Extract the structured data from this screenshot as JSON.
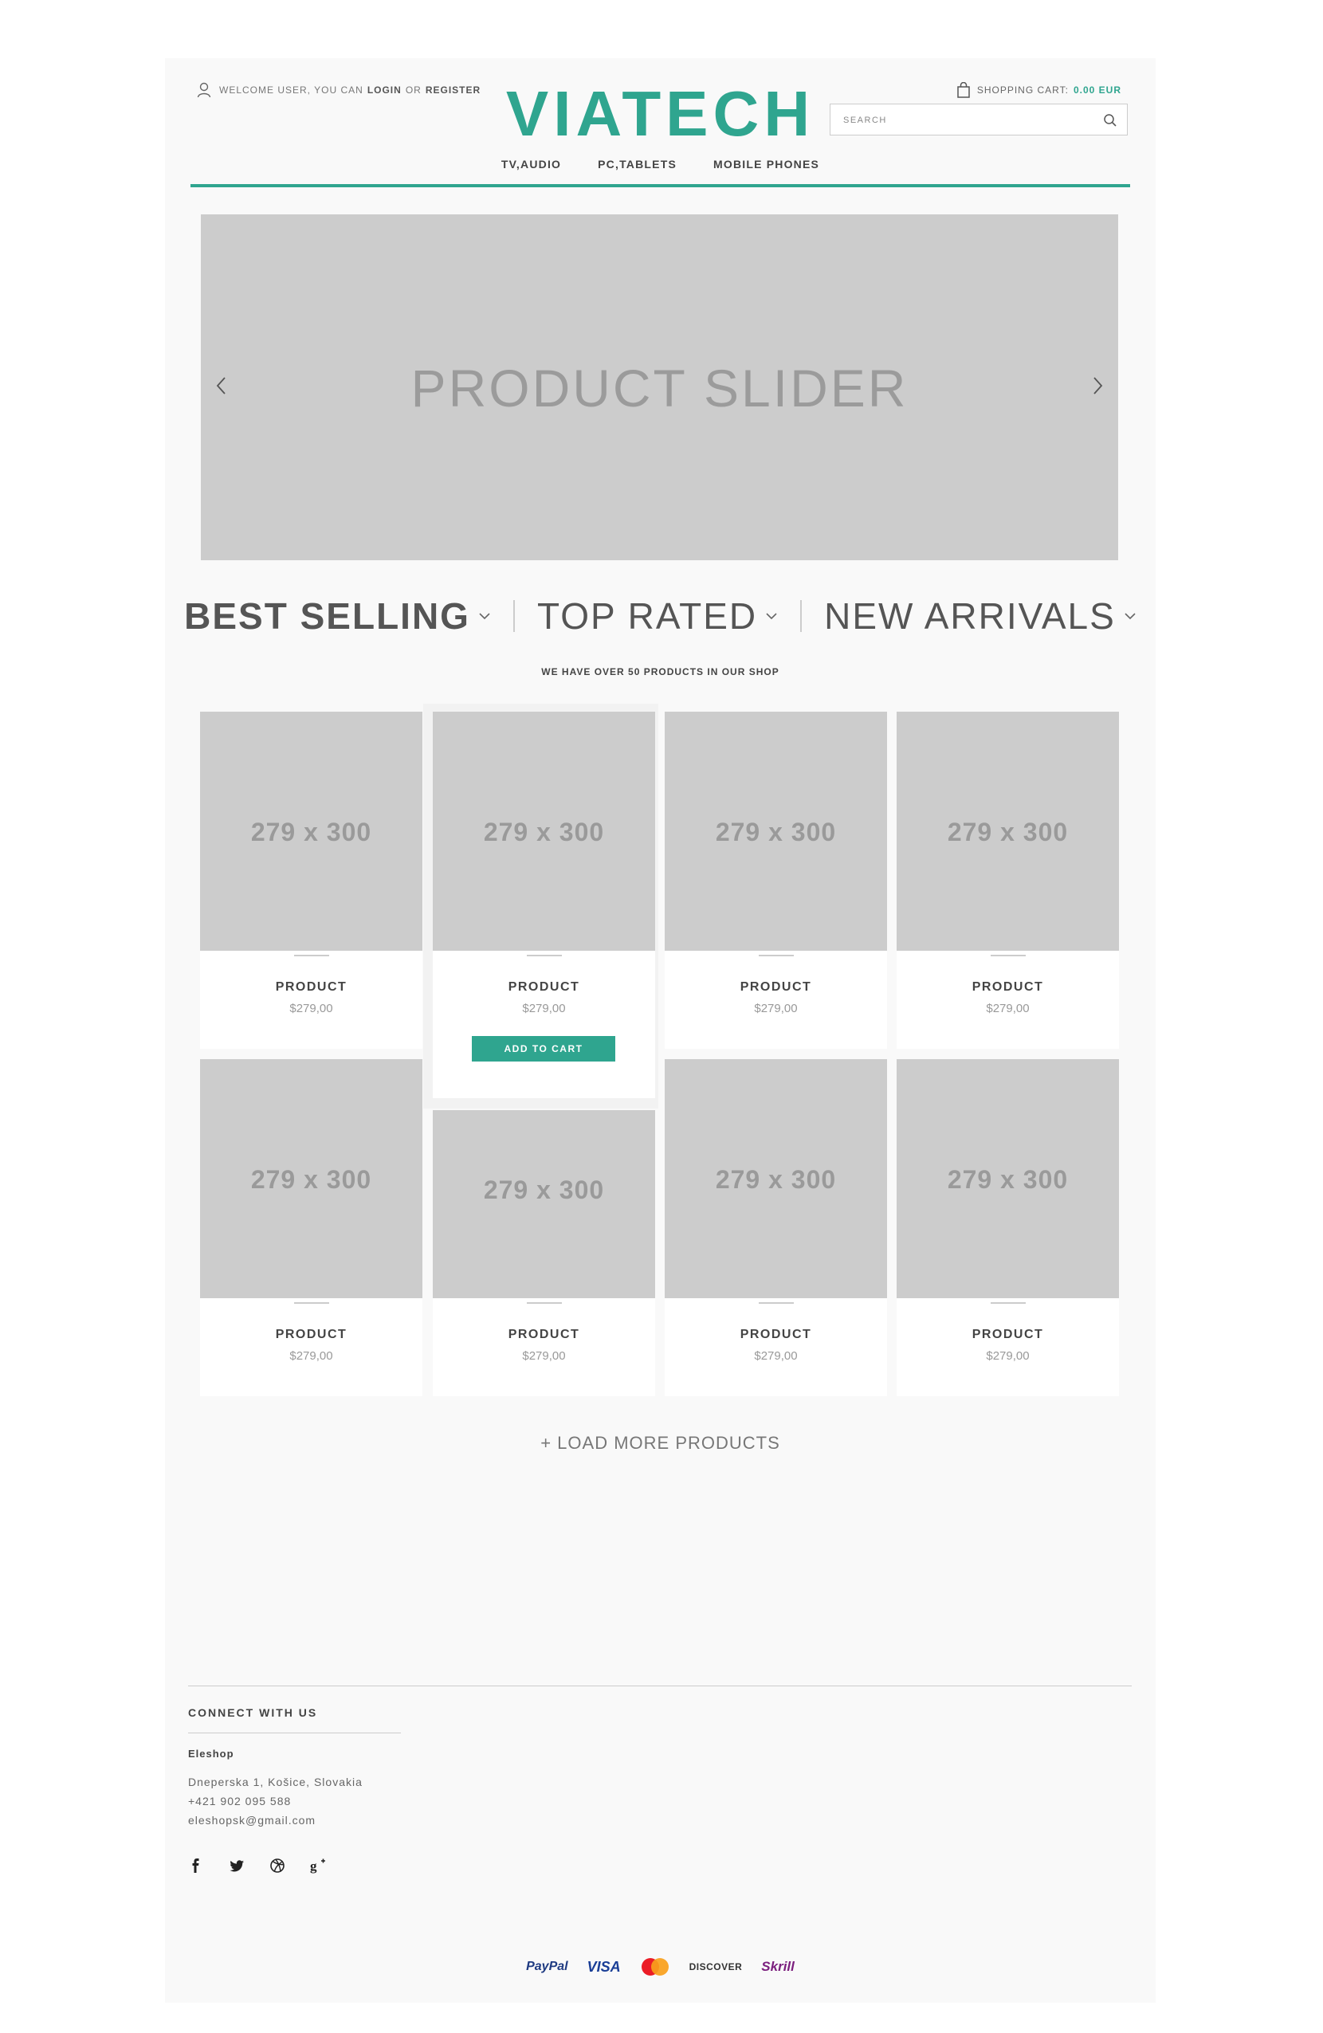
{
  "header": {
    "welcome_text": "WELCOME USER, YOU CAN",
    "login_label": "LOGIN",
    "or_text": "OR",
    "register_label": "REGISTER",
    "logo": "VIATECH",
    "cart_label": "SHOPPING CART:",
    "cart_amount": "0.00 EUR",
    "search_placeholder": "SEARCH"
  },
  "nav": {
    "items": [
      "TV,AUDIO",
      "PC,TABLETS",
      "MOBILE PHONES"
    ]
  },
  "slider": {
    "title": "PRODUCT SLIDER"
  },
  "tabs": {
    "items": [
      "BEST SELLING",
      "TOP RATED",
      "NEW ARRIVALS"
    ],
    "active": "BEST SELLING",
    "subtitle": "WE HAVE OVER 50 PRODUCTS IN OUR SHOP"
  },
  "products": [
    {
      "image_label": "279 x 300",
      "name": "PRODUCT",
      "price": "$279,00"
    },
    {
      "image_label": "279 x 300",
      "name": "PRODUCT",
      "price": "$279,00",
      "add_to_cart": "ADD TO CART"
    },
    {
      "image_label": "279 x 300",
      "name": "PRODUCT",
      "price": "$279,00"
    },
    {
      "image_label": "279 x 300",
      "name": "PRODUCT",
      "price": "$279,00"
    },
    {
      "image_label": "279 x 300",
      "name": "PRODUCT",
      "price": "$279,00"
    },
    {
      "image_label": "279 x 300",
      "name": "PRODUCT",
      "price": "$279,00"
    },
    {
      "image_label": "279 x 300",
      "name": "PRODUCT",
      "price": "$279,00"
    },
    {
      "image_label": "279 x 300",
      "name": "PRODUCT",
      "price": "$279,00"
    }
  ],
  "load_more": "+ LOAD MORE PRODUCTS",
  "footer": {
    "connect_title": "CONNECT WITH US",
    "company": "Eleshop",
    "address": "Dneperska 1, Košice, Slovakia",
    "phone": "+421 902 095 588",
    "email": "eleshopsk@gmail.com",
    "social_icons": [
      "facebook-icon",
      "twitter-icon",
      "dribbble-icon",
      "google-plus-icon"
    ],
    "payments": {
      "paypal": "PayPal",
      "visa": "VISA",
      "mastercard_icon": "mastercard-icon",
      "discover": "DISCOVER",
      "skrill": "Skrill"
    }
  },
  "colors": {
    "accent": "#2fa58f",
    "placeholder": "#cccccc",
    "page_bg": "#f9f9f9"
  }
}
